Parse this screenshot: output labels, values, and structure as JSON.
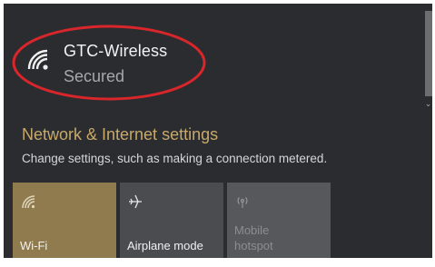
{
  "network": {
    "name": "GTC-Wireless",
    "status": "Secured"
  },
  "settings": {
    "link": "Network & Internet settings",
    "description": "Change settings, such as making a connection metered."
  },
  "quick_actions": [
    {
      "label": "Wi-Fi",
      "icon": "wifi-icon",
      "active": true
    },
    {
      "label": "Airplane mode",
      "icon": "airplane-icon",
      "active": false
    },
    {
      "label_line1": "Mobile",
      "label_line2": "hotspot",
      "icon": "hotspot-icon",
      "active": false
    }
  ],
  "colors": {
    "panel_background": "#2a2c30",
    "accent": "#c8a96a",
    "active_tile": "#8f7b4e",
    "annotation": "#d9262b"
  }
}
